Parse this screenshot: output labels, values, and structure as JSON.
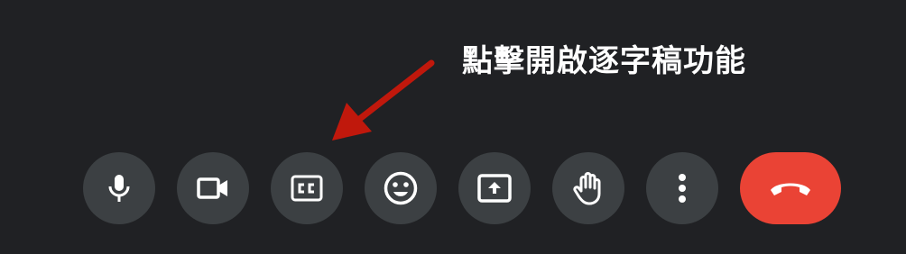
{
  "annotation": {
    "text": "點擊開啟逐字稿功能",
    "arrow_color": "#c0180c"
  },
  "toolbar": {
    "buttons": [
      {
        "name": "microphone",
        "icon": "microphone-icon"
      },
      {
        "name": "camera",
        "icon": "video-camera-icon"
      },
      {
        "name": "captions",
        "icon": "closed-captions-icon"
      },
      {
        "name": "reactions",
        "icon": "emoji-icon"
      },
      {
        "name": "present",
        "icon": "present-screen-icon"
      },
      {
        "name": "raise-hand",
        "icon": "hand-icon"
      },
      {
        "name": "more-options",
        "icon": "more-vert-icon"
      },
      {
        "name": "leave-call",
        "icon": "hang-up-icon"
      }
    ],
    "button_color": "#3c4043",
    "end_call_color": "#ea4335",
    "icon_color": "#ffffff"
  }
}
